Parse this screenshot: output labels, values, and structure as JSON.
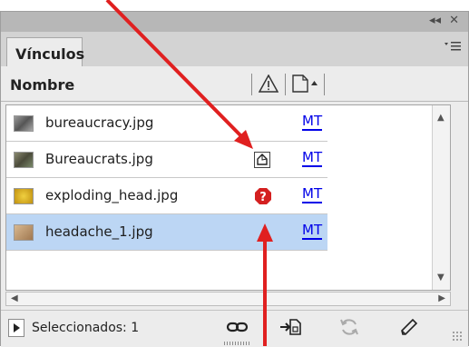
{
  "panel": {
    "title_buttons": [
      "◂◂",
      "✕"
    ],
    "tab_label": "Vínculos",
    "menu_icon": "panel-menu-icon"
  },
  "header": {
    "name_label": "Nombre"
  },
  "links": [
    {
      "file": "bureaucracy.jpg",
      "status_icon": "",
      "source": "MT",
      "thumb_color": "#7b7b7b",
      "selected": false
    },
    {
      "file": "Bureaucrats.jpg",
      "status_icon": "modified-icon",
      "source": "MT",
      "thumb_color": "#6a6a5a",
      "selected": false
    },
    {
      "file": "exploding_head.jpg",
      "status_icon": "missing-link-icon",
      "source": "MT",
      "thumb_color": "#d4b21c",
      "selected": false
    },
    {
      "file": "headache_1.jpg",
      "status_icon": "",
      "source": "MT",
      "thumb_color": "#c8a070",
      "selected": true
    }
  ],
  "footer": {
    "selected_label": "Seleccionados: 1",
    "icons": [
      "relink-icon",
      "go-to-link-icon",
      "update-link-icon",
      "edit-original-icon"
    ]
  },
  "colors": {
    "annotation_arrow": "#e02020",
    "selection": "#bcd6f4",
    "missing": "#d42020"
  }
}
